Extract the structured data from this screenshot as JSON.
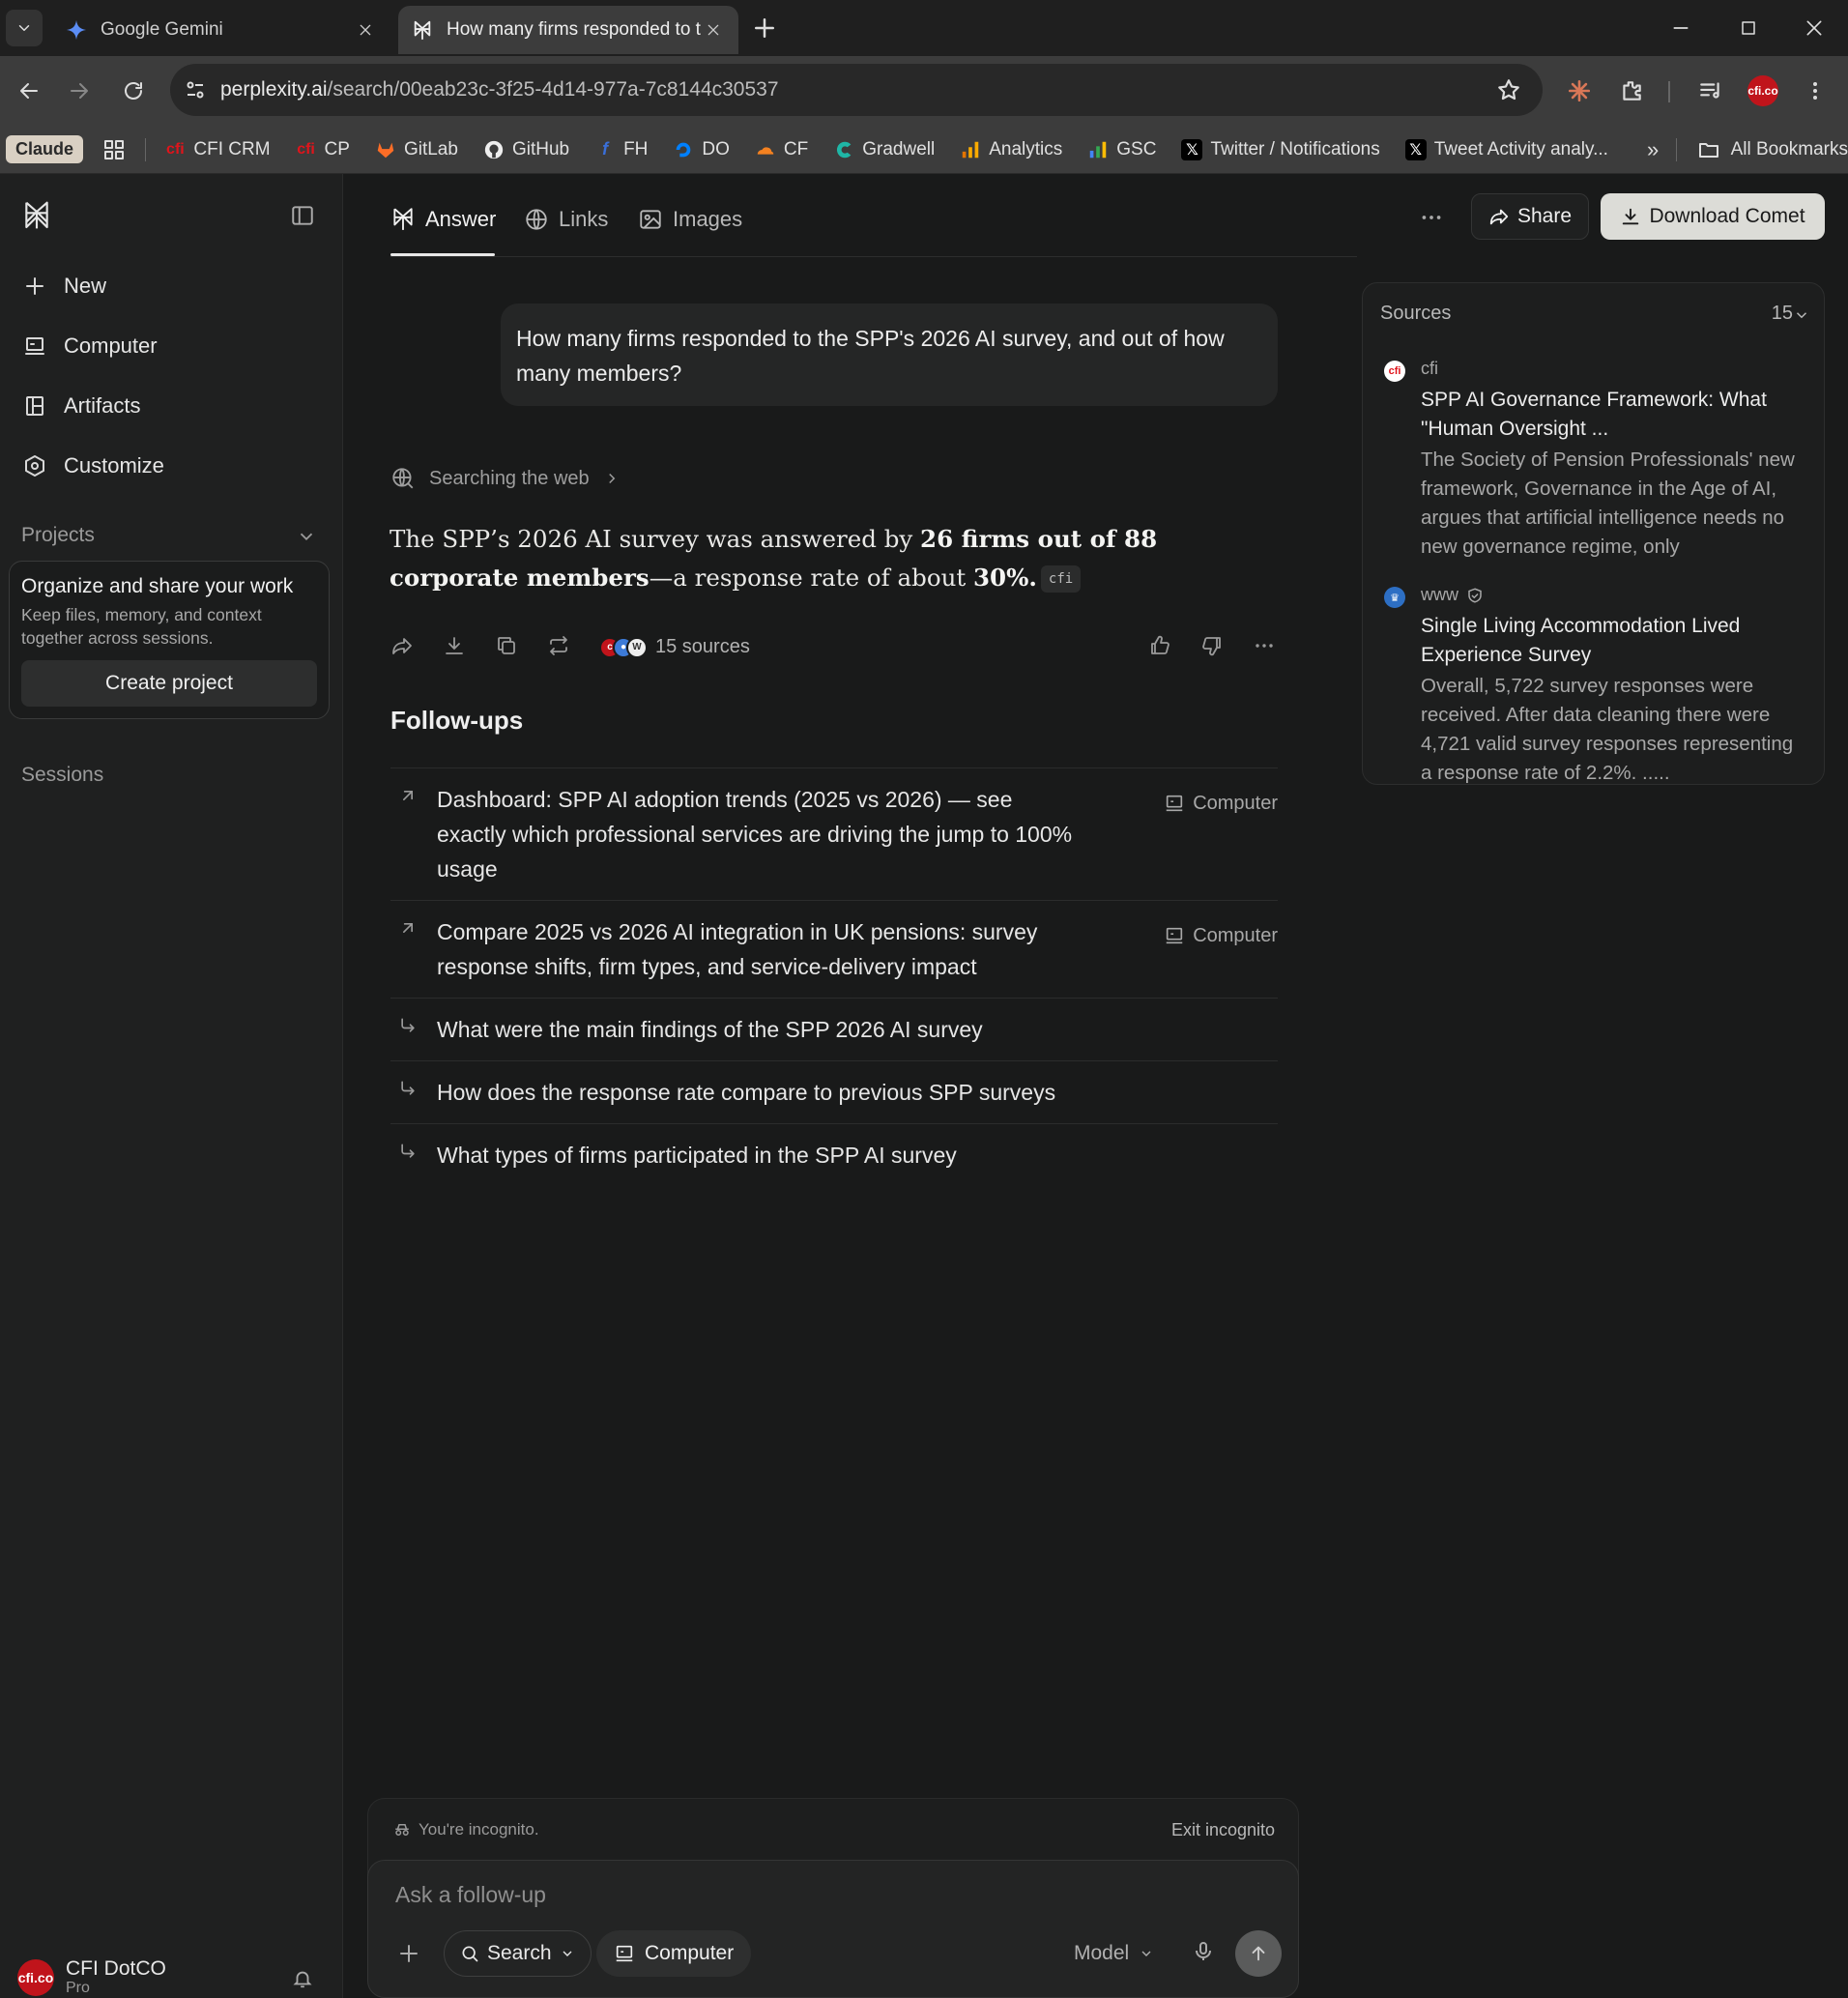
{
  "browser": {
    "tabs": [
      {
        "title": "Google Gemini",
        "icon": "gemini-sparkle-icon",
        "active": false
      },
      {
        "title": "How many firms responded to t",
        "icon": "perplexity-icon",
        "active": true
      }
    ],
    "url": {
      "domain": "perplexity.ai",
      "path": "/search/00eab23c-3f25-4d14-977a-7c8144c30537"
    },
    "bookmarks": [
      {
        "label": "Claude",
        "icon": "claude-badge"
      },
      {
        "label": "",
        "icon": "apps-grid-icon"
      },
      {
        "label": "CFI CRM",
        "icon": "cfi-icon"
      },
      {
        "label": "CP",
        "icon": "cfi-icon"
      },
      {
        "label": "GitLab",
        "icon": "gitlab-icon"
      },
      {
        "label": "GitHub",
        "icon": "github-icon"
      },
      {
        "label": "FH",
        "icon": "fh-icon"
      },
      {
        "label": "DO",
        "icon": "digitalocean-icon"
      },
      {
        "label": "CF",
        "icon": "cloudflare-icon"
      },
      {
        "label": "Gradwell",
        "icon": "gradwell-icon"
      },
      {
        "label": "Analytics",
        "icon": "analytics-icon"
      },
      {
        "label": "GSC",
        "icon": "gsc-icon"
      },
      {
        "label": "Twitter / Notifications",
        "icon": "x-icon"
      },
      {
        "label": "Tweet Activity analy...",
        "icon": "x-icon"
      }
    ],
    "all_bookmarks_label": "All Bookmarks"
  },
  "sidebar": {
    "nav": [
      {
        "label": "New",
        "icon": "plus-icon"
      },
      {
        "label": "Computer",
        "icon": "computer-icon"
      },
      {
        "label": "Artifacts",
        "icon": "artifacts-icon"
      },
      {
        "label": "Customize",
        "icon": "customize-icon"
      }
    ],
    "projects_label": "Projects",
    "project_card": {
      "title": "Organize and share your work",
      "description": "Keep files, memory, and context together across sessions.",
      "button": "Create project"
    },
    "sessions_label": "Sessions",
    "account": {
      "avatar_text": "cfi.co",
      "name": "CFI DotCO",
      "plan": "Pro"
    }
  },
  "tabs": {
    "answer": "Answer",
    "links": "Links",
    "images": "Images"
  },
  "header": {
    "share": "Share",
    "download": "Download Comet"
  },
  "question": "How many firms responded to the SPP's 2026 AI survey, and out of how many members?",
  "searching": "Searching the web",
  "answer": {
    "pre": "The SPP’s 2026 AI survey was answered by ",
    "bold1": "26 firms out of 88 corporate members",
    "mid": "—a response rate of about ",
    "bold2": "30%.",
    "citation": "cfi"
  },
  "sources_summary": "15 sources",
  "followups_title": "Follow-ups",
  "followups": [
    {
      "text": "Dashboard: SPP AI adoption trends (2025 vs 2026) — see exactly which professional services are driving the jump to 100% usage",
      "badge": "Computer",
      "icon": "arrow-up-right-icon"
    },
    {
      "text": "Compare 2025 vs 2026 AI integration in UK pensions: survey response shifts, firm types, and service-delivery impact",
      "badge": "Computer",
      "icon": "arrow-up-right-icon"
    },
    {
      "text": "What were the main findings of the SPP 2026 AI survey",
      "badge": "",
      "icon": "corner-down-right-icon"
    },
    {
      "text": "How does the response rate compare to previous SPP surveys",
      "badge": "",
      "icon": "corner-down-right-icon"
    },
    {
      "text": "What types of firms participated in the SPP AI survey",
      "badge": "",
      "icon": "corner-down-right-icon"
    }
  ],
  "sources_panel": {
    "label": "Sources",
    "count": "15",
    "items": [
      {
        "domain": "cfi",
        "title": "SPP AI Governance Framework: What \"Human Oversight ...",
        "snippet": "The Society of Pension Professionals' new framework, Governance in the Age of AI, argues that artificial intelligence needs no new governance regime, only"
      },
      {
        "domain": "www",
        "title": "Single Living Accommodation Lived Experience Survey",
        "snippet": "Overall, 5,722 survey responses were received. After data cleaning there were 4,721 valid survey responses representing a response rate of 2.2%. ....."
      }
    ]
  },
  "composer": {
    "incognito": "You're incognito.",
    "exit_incognito": "Exit incognito",
    "placeholder": "Ask a follow-up",
    "search": "Search",
    "computer": "Computer",
    "model": "Model"
  }
}
